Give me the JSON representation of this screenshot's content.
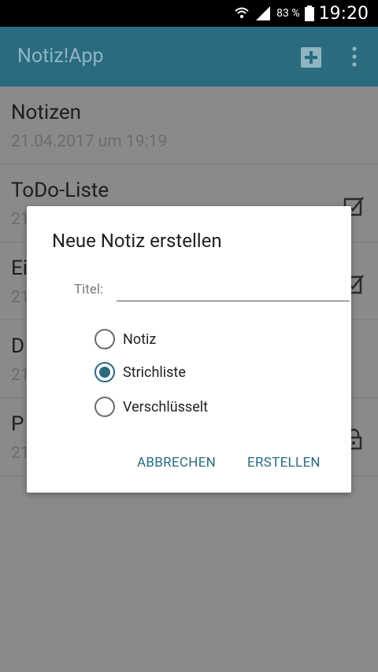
{
  "status": {
    "battery": "83 %",
    "time": "19:20"
  },
  "appbar": {
    "title": "Notiz!App"
  },
  "list": {
    "items": [
      {
        "title": "Notizen",
        "date": "21.04.2017 um 19:19",
        "icon": ""
      },
      {
        "title": "ToDo-Liste",
        "date": "21",
        "icon": "checklist-icon"
      },
      {
        "title": "Ei",
        "date": "21",
        "icon": "checklist-icon"
      },
      {
        "title": "D",
        "date": "21",
        "icon": ""
      },
      {
        "title": "P",
        "date": "21",
        "icon": "lock-icon"
      }
    ]
  },
  "dialog": {
    "title": "Neue Notiz erstellen",
    "field_label": "Titel:",
    "field_value": "",
    "options": [
      {
        "label": "Notiz",
        "checked": false
      },
      {
        "label": "Strichliste",
        "checked": true
      },
      {
        "label": "Verschlüsselt",
        "checked": false
      }
    ],
    "cancel": "ABBRECHEN",
    "create": "ERSTELLEN"
  },
  "colors": {
    "accent": "#2a6b80",
    "scrim": "#8a8a8a"
  }
}
